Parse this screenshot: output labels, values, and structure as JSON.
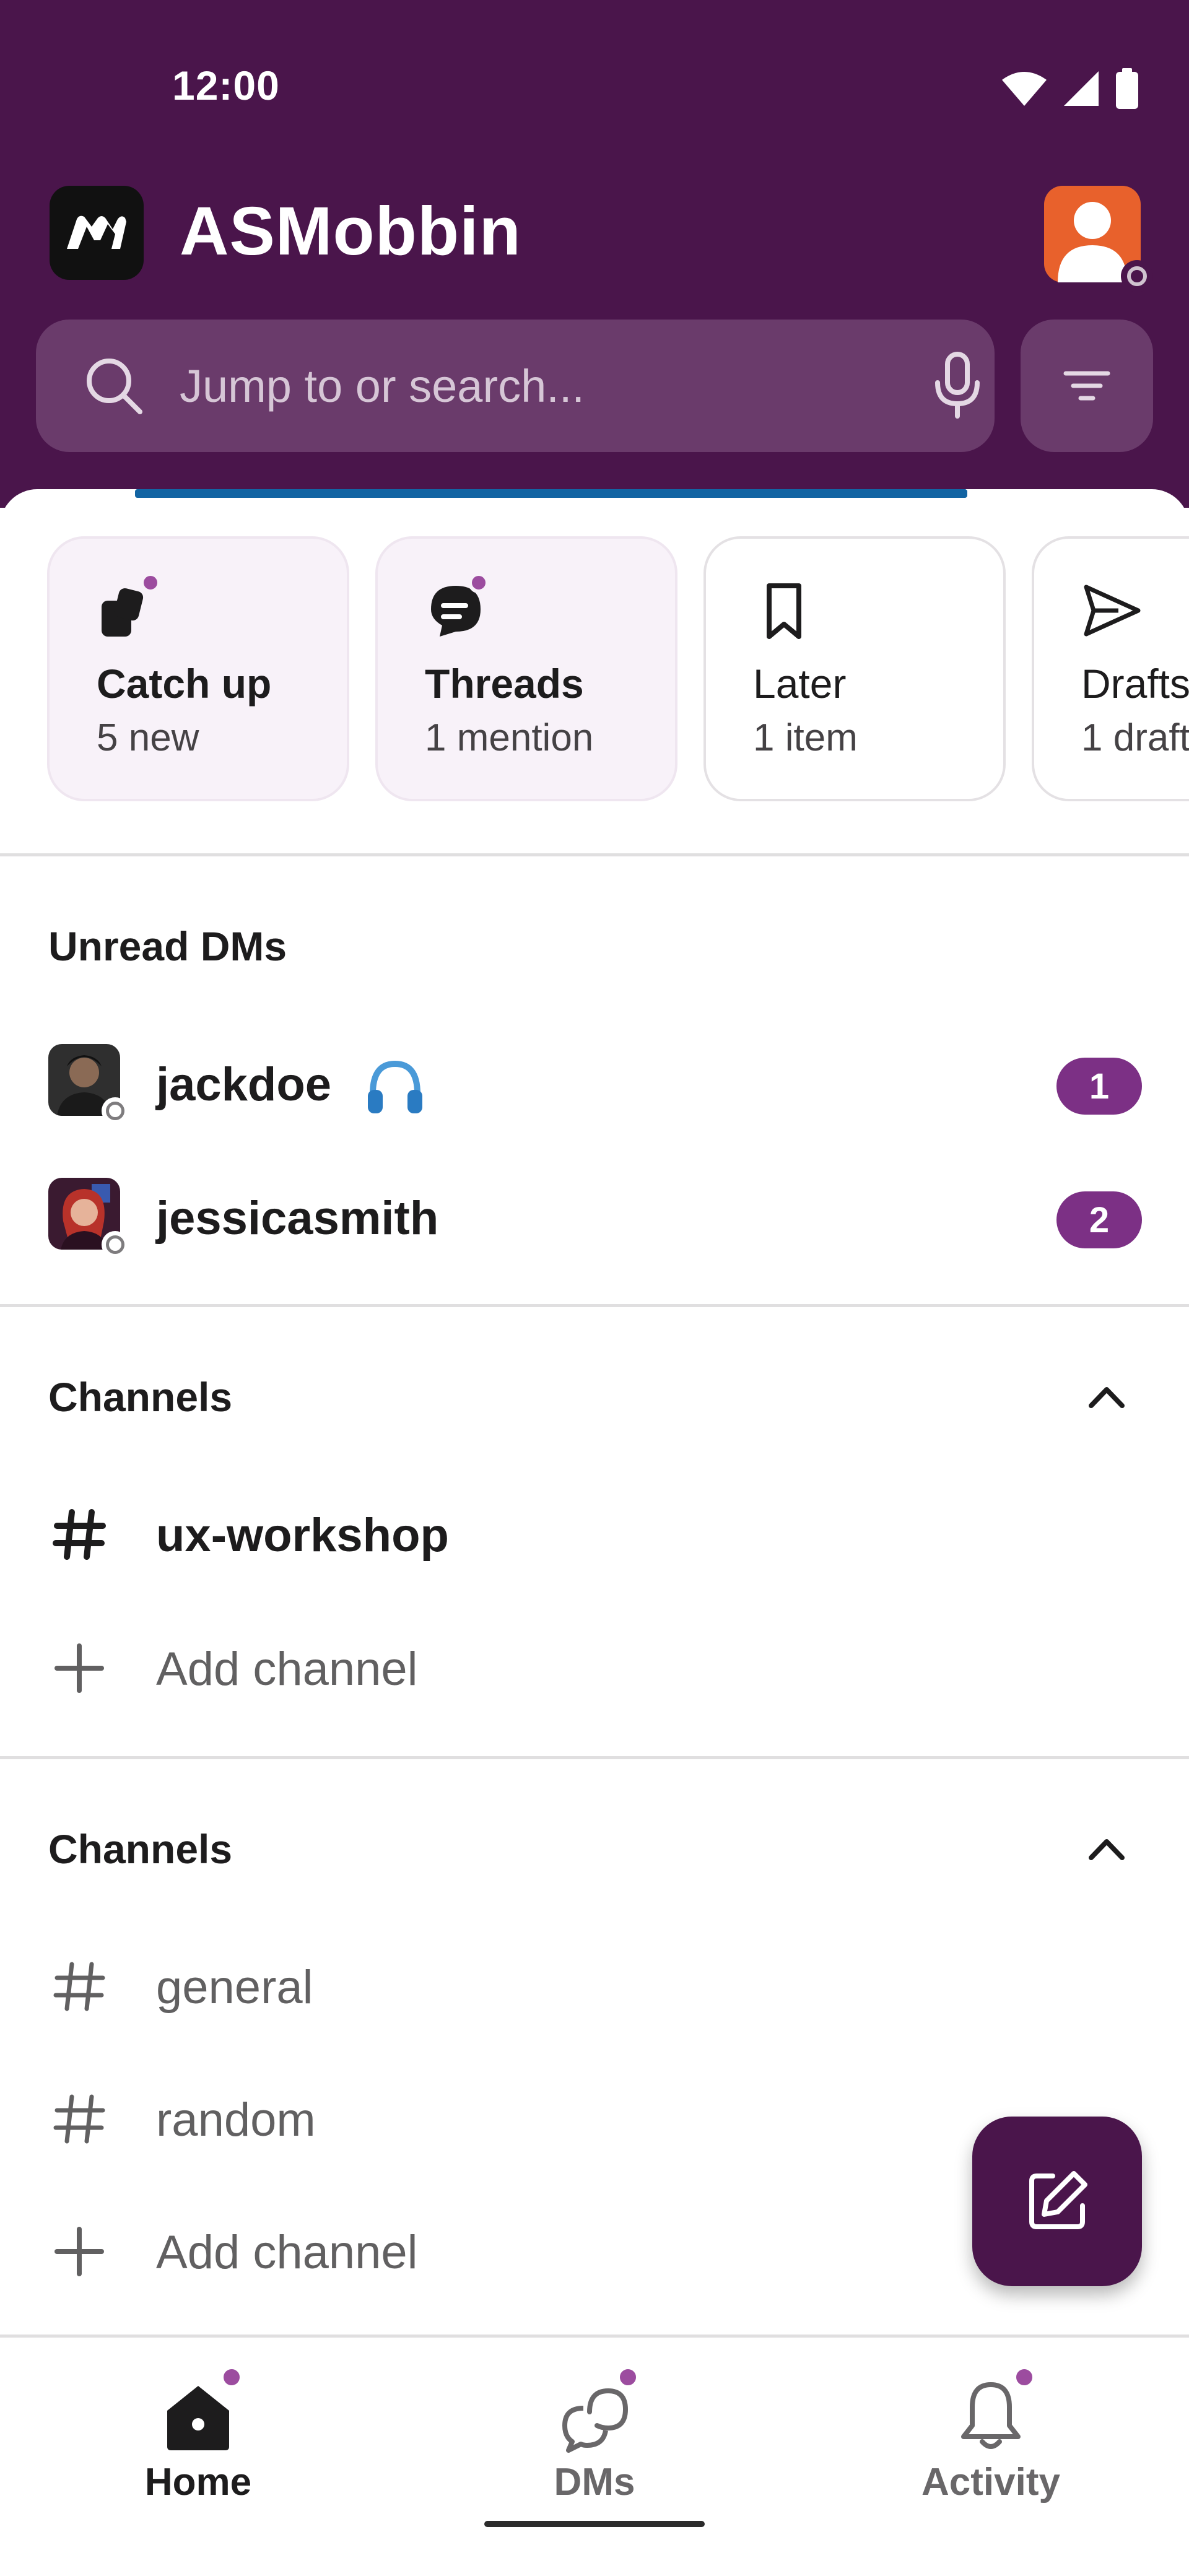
{
  "status_bar": {
    "time": "12:00"
  },
  "workspace": {
    "name": "ASMobbin"
  },
  "search": {
    "placeholder": "Jump to or search..."
  },
  "cards": [
    {
      "icon": "catch-up-icon",
      "title": "Catch up",
      "subtitle": "5 new",
      "highlight": true,
      "dot": true
    },
    {
      "icon": "threads-icon",
      "title": "Threads",
      "subtitle": "1 mention",
      "highlight": true,
      "dot": true
    },
    {
      "icon": "bookmark-icon",
      "title": "Later",
      "subtitle": "1 item",
      "highlight": false,
      "dot": false
    },
    {
      "icon": "send-icon",
      "title": "Drafts",
      "subtitle": "1 draft",
      "highlight": false,
      "dot": false
    }
  ],
  "unread_dms": {
    "title": "Unread DMs",
    "items": [
      {
        "name": "jackdoe",
        "status_emoji": "headphones-icon",
        "count": "1"
      },
      {
        "name": "jessicasmith",
        "count": "2"
      }
    ]
  },
  "channels_1": {
    "title": "Channels",
    "items": [
      {
        "label": "ux-workshop",
        "icon": "hash-icon",
        "bold": true
      },
      {
        "label": "Add channel",
        "icon": "plus-icon",
        "bold": false
      }
    ]
  },
  "channels_2": {
    "title": "Channels",
    "items": [
      {
        "label": "general",
        "icon": "hash-icon",
        "bold": false
      },
      {
        "label": "random",
        "icon": "hash-icon",
        "bold": false
      },
      {
        "label": "Add channel",
        "icon": "plus-icon",
        "bold": false
      }
    ]
  },
  "nav": [
    {
      "label": "Home",
      "icon": "home-icon",
      "active": true
    },
    {
      "label": "DMs",
      "icon": "dms-icon",
      "active": false
    },
    {
      "label": "Activity",
      "icon": "bell-icon",
      "active": false
    }
  ],
  "colors": {
    "header_bg": "#4a154b",
    "search_bg": "#6a3b6b",
    "badge_bg": "#7c3085",
    "accent_dot": "#9c4c9f",
    "progress": "#1264a3"
  }
}
